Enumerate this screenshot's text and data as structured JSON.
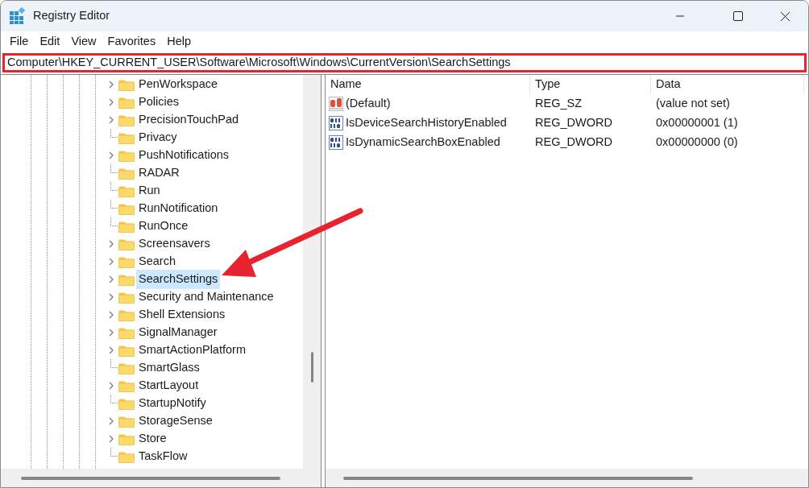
{
  "window": {
    "title": "Registry Editor"
  },
  "menu": [
    "File",
    "Edit",
    "View",
    "Favorites",
    "Help"
  ],
  "address": {
    "value": "Computer\\HKEY_CURRENT_USER\\Software\\Microsoft\\Windows\\CurrentVersion\\SearchSettings",
    "highlighted": true
  },
  "tree": {
    "items": [
      {
        "label": "PenWorkspace",
        "expandable": true,
        "selected": false
      },
      {
        "label": "Policies",
        "expandable": true,
        "selected": false
      },
      {
        "label": "PrecisionTouchPad",
        "expandable": true,
        "selected": false
      },
      {
        "label": "Privacy",
        "expandable": false,
        "selected": false
      },
      {
        "label": "PushNotifications",
        "expandable": true,
        "selected": false
      },
      {
        "label": "RADAR",
        "expandable": false,
        "selected": false
      },
      {
        "label": "Run",
        "expandable": false,
        "selected": false
      },
      {
        "label": "RunNotification",
        "expandable": false,
        "selected": false
      },
      {
        "label": "RunOnce",
        "expandable": false,
        "selected": false
      },
      {
        "label": "Screensavers",
        "expandable": true,
        "selected": false
      },
      {
        "label": "Search",
        "expandable": true,
        "selected": false
      },
      {
        "label": "SearchSettings",
        "expandable": true,
        "selected": true
      },
      {
        "label": "Security and Maintenance",
        "expandable": true,
        "selected": false
      },
      {
        "label": "Shell Extensions",
        "expandable": true,
        "selected": false
      },
      {
        "label": "SignalManager",
        "expandable": true,
        "selected": false
      },
      {
        "label": "SmartActionPlatform",
        "expandable": true,
        "selected": false
      },
      {
        "label": "SmartGlass",
        "expandable": false,
        "selected": false
      },
      {
        "label": "StartLayout",
        "expandable": true,
        "selected": false
      },
      {
        "label": "StartupNotify",
        "expandable": false,
        "selected": false
      },
      {
        "label": "StorageSense",
        "expandable": true,
        "selected": false
      },
      {
        "label": "Store",
        "expandable": true,
        "selected": false
      },
      {
        "label": "TaskFlow",
        "expandable": false,
        "selected": false
      }
    ]
  },
  "values": {
    "columns": [
      "Name",
      "Type",
      "Data"
    ],
    "rows": [
      {
        "kind": "string",
        "name": "(Default)",
        "type": "REG_SZ",
        "data": "(value not set)"
      },
      {
        "kind": "binary",
        "name": "IsDeviceSearchHistoryEnabled",
        "type": "REG_DWORD",
        "data": "0x00000001 (1)"
      },
      {
        "kind": "binary",
        "name": "IsDynamicSearchBoxEnabled",
        "type": "REG_DWORD",
        "data": "0x00000000 (0)"
      }
    ]
  },
  "annotation": {
    "arrow": true
  }
}
